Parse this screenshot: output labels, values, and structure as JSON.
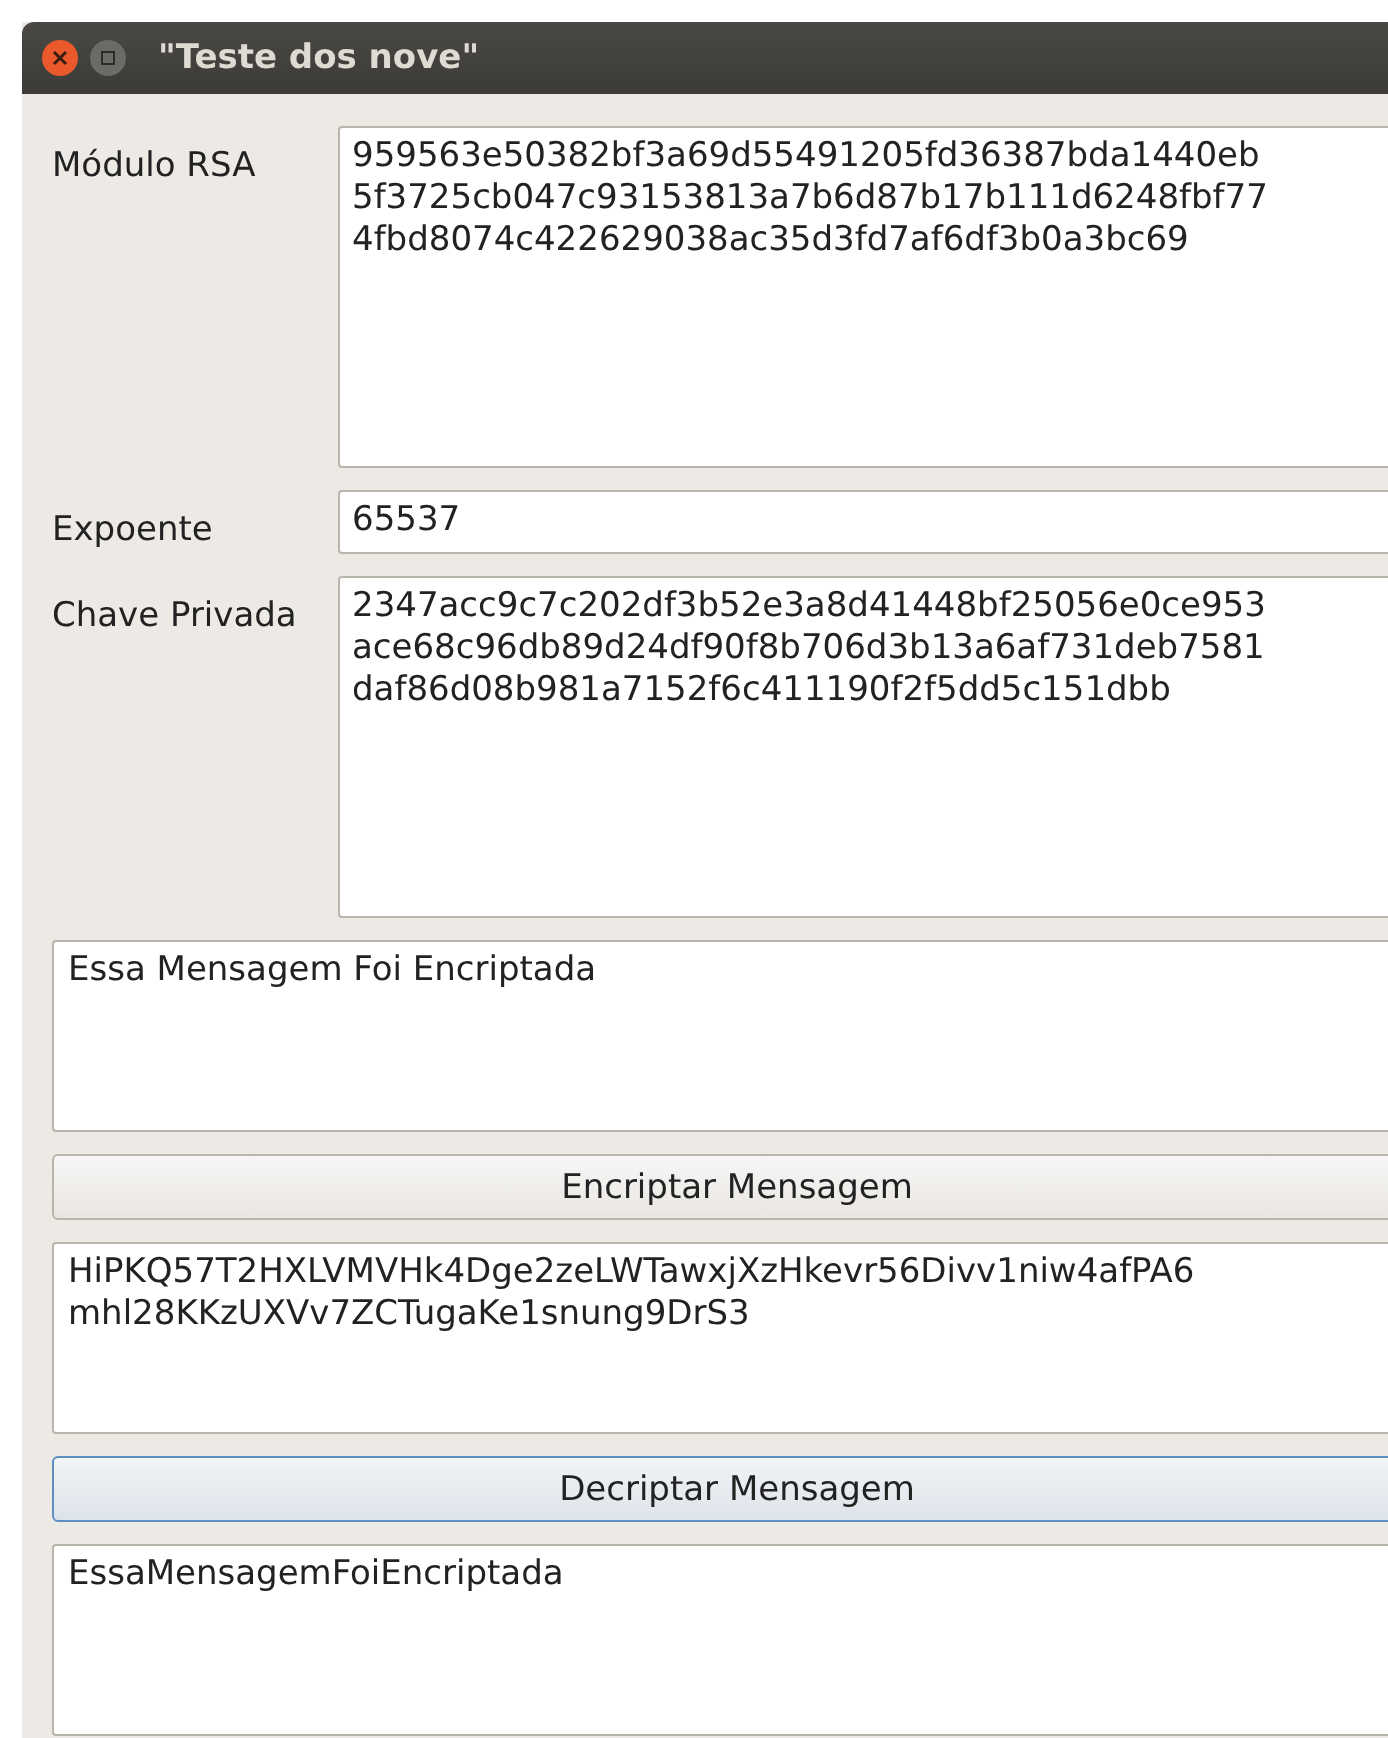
{
  "window": {
    "title": "\"Teste dos nove\""
  },
  "fields": [
    {
      "label": "Módulo RSA",
      "kind": "multiline",
      "lines": [
        "959563e50382bf3a69d55491205fd36387bda1440eb",
        "5f3725cb047c93153813a7b6d87b17b111d6248fbf77",
        "4fbd8074c422629038ac35d3fd7af6df3b0a3bc69"
      ]
    },
    {
      "label": "Expoente",
      "kind": "single",
      "lines": [
        "65537"
      ]
    },
    {
      "label": "Chave Privada",
      "kind": "multiline",
      "lines": [
        "2347acc9c7c202df3b52e3a8d41448bf25056e0ce953",
        "ace68c96db89d24df90f8b706d3b13a6af731deb7581",
        "daf86d08b981a7152f6c411190f2f5dd5c151dbb"
      ]
    }
  ],
  "sections": [
    {
      "kind": "textarea",
      "lines": [
        "Essa Mensagem Foi Encriptada"
      ]
    },
    {
      "kind": "button",
      "label": "Encriptar Mensagem",
      "focused": false
    },
    {
      "kind": "textarea",
      "lines": [
        "HiPKQ57T2HXLVMVHk4Dge2zeLWTawxjXzHkevr56Divv1niw4afPA6",
        "mhl28KKzUXVv7ZCTugaKe1snung9DrS3"
      ]
    },
    {
      "kind": "button",
      "label": "Decriptar Mensagem",
      "focused": true
    },
    {
      "kind": "textarea",
      "lines": [
        "EssaMensagemFoiEncriptada"
      ]
    }
  ]
}
